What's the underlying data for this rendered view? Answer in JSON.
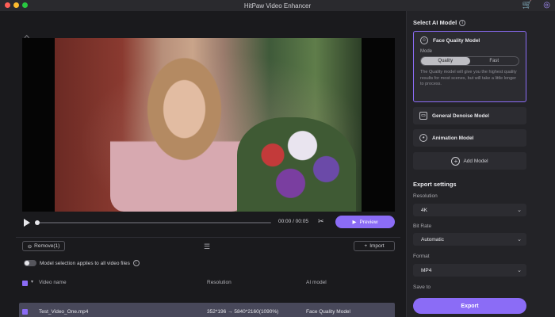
{
  "window": {
    "title": "HitPaw Video Enhancer"
  },
  "player": {
    "timecode": "00:00 / 00:05",
    "preview_label": "Preview",
    "progress": 0.0
  },
  "files": {
    "remove_label": "Remove(1)",
    "import_label": "Import",
    "toggle_label": "Model selection applies to all video files",
    "columns": {
      "name": "Video name",
      "resolution": "Resolution",
      "ai_model": "AI model"
    },
    "rows": [
      {
        "name": "Test_Video_One.mp4",
        "resolution": "352*196 → 5840*2160(1090%)",
        "ai_model": "Face Quality Model"
      }
    ]
  },
  "ai_panel": {
    "title": "Select AI Model",
    "models": [
      {
        "name": "Face Quality Model",
        "selected": true
      },
      {
        "name": "General Denoise Model",
        "selected": false
      },
      {
        "name": "Animation Model",
        "selected": false
      }
    ],
    "mode_label": "Mode",
    "mode_options": [
      "Quality",
      "Fast"
    ],
    "mode_selected": "Quality",
    "description": "The Quality model will give you the highest quality results for most scenes, but will take a little longer to process.",
    "add_model_label": "Add Model"
  },
  "export": {
    "title": "Export settings",
    "resolution_label": "Resolution",
    "resolution_value": "4K",
    "bitrate_label": "Bit Rate",
    "bitrate_value": "Automatic",
    "format_label": "Format",
    "format_value": "MP4",
    "save_to_label": "Save to",
    "export_label": "Export"
  },
  "colors": {
    "accent": "#8b6cf6",
    "panel": "#232327",
    "background": "#1a1a1d"
  }
}
